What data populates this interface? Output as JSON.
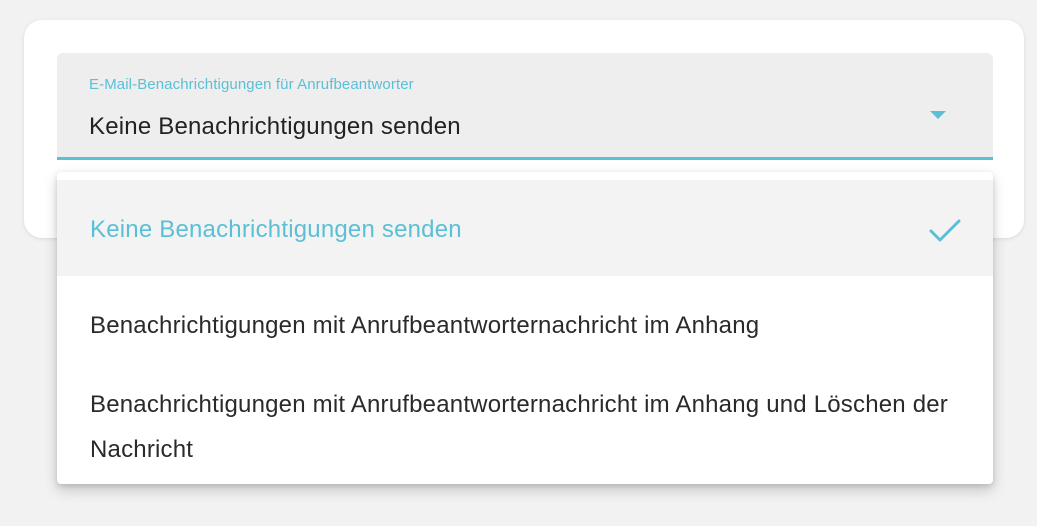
{
  "field": {
    "label": "E-Mail-Benachrichtigungen für Anrufbeantworter",
    "value": "Keine Benachrichtigungen senden"
  },
  "menu": {
    "items": [
      {
        "label": "Keine Benachrichtigungen senden",
        "selected": true
      },
      {
        "label": "Benachrichtigungen mit Anrufbeantworternachricht im Anhang",
        "selected": false
      },
      {
        "label": "Benachrichtigungen mit Anrufbeantworternachricht im Anhang und Löschen der Nachricht",
        "selected": false
      }
    ]
  },
  "colors": {
    "accent": "#5bbfd6",
    "field_background": "#eeeeee",
    "page_background": "#f2f2f2"
  },
  "icons": {
    "dropdown": "caret-down-icon",
    "selected": "check-icon"
  }
}
